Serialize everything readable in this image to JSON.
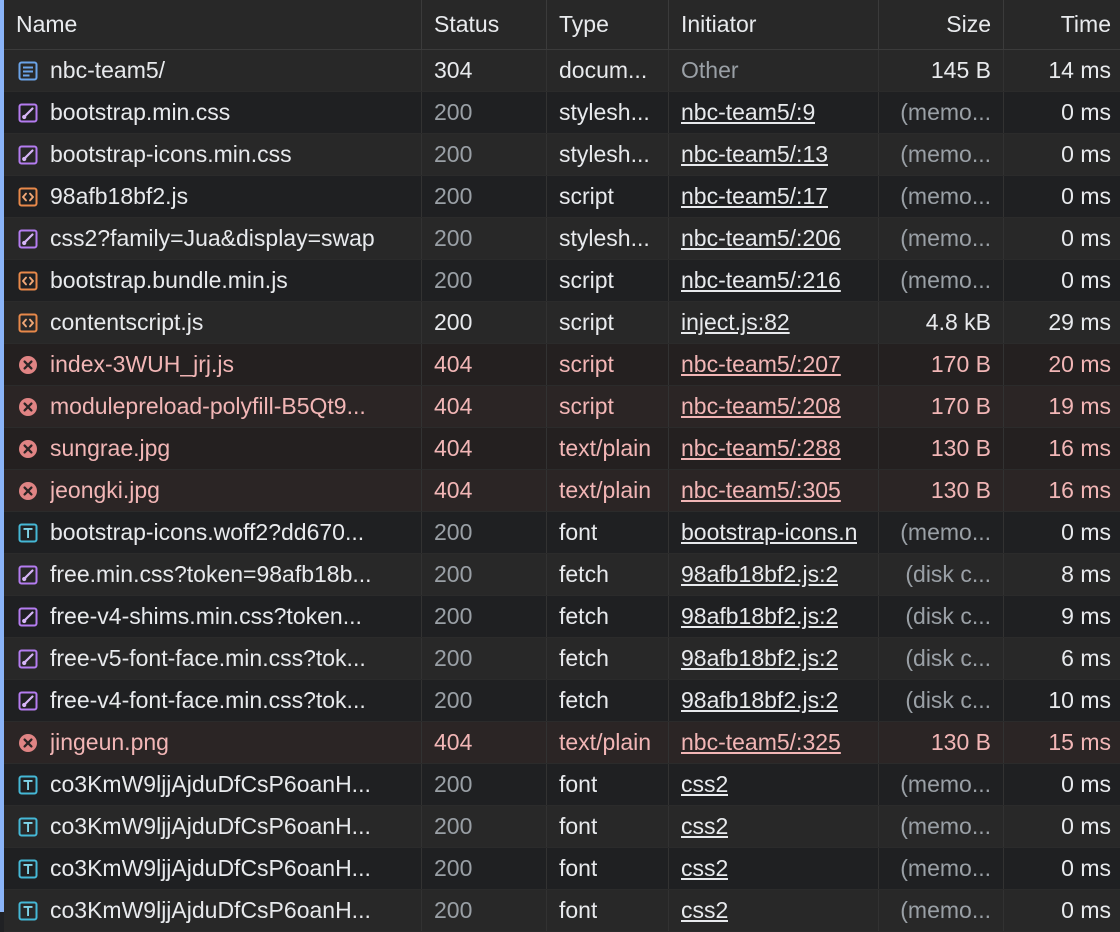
{
  "panel": {
    "name": "network-requests-table",
    "accent_color": "#8ab4f8",
    "error_text_color": "#f2b6b6",
    "muted_text_color": "#9aa0a6"
  },
  "columns": [
    {
      "key": "name",
      "label": "Name"
    },
    {
      "key": "status",
      "label": "Status"
    },
    {
      "key": "type",
      "label": "Type"
    },
    {
      "key": "initiator",
      "label": "Initiator"
    },
    {
      "key": "size",
      "label": "Size"
    },
    {
      "key": "time",
      "label": "Time"
    }
  ],
  "rows": [
    {
      "icon": "document-icon",
      "name": "nbc-team5/",
      "status": "304",
      "status_style": "bright",
      "type": "docum...",
      "initiator": "Other",
      "initiator_style": "plain-muted",
      "size": "145 B",
      "size_style": "bright",
      "time": "14 ms",
      "error": false
    },
    {
      "icon": "stylesheet-icon",
      "name": "bootstrap.min.css",
      "status": "200",
      "status_style": "muted",
      "type": "stylesh...",
      "initiator": "nbc-team5/:9",
      "initiator_style": "link",
      "size": "(memo...",
      "size_style": "muted",
      "time": "0 ms",
      "error": false
    },
    {
      "icon": "stylesheet-icon",
      "name": "bootstrap-icons.min.css",
      "status": "200",
      "status_style": "muted",
      "type": "stylesh...",
      "initiator": "nbc-team5/:13",
      "initiator_style": "link",
      "size": "(memo...",
      "size_style": "muted",
      "time": "0 ms",
      "error": false
    },
    {
      "icon": "script-icon",
      "name": "98afb18bf2.js",
      "status": "200",
      "status_style": "muted",
      "type": "script",
      "initiator": "nbc-team5/:17",
      "initiator_style": "link",
      "size": "(memo...",
      "size_style": "muted",
      "time": "0 ms",
      "error": false
    },
    {
      "icon": "stylesheet-icon",
      "name": "css2?family=Jua&display=swap",
      "status": "200",
      "status_style": "muted",
      "type": "stylesh...",
      "initiator": "nbc-team5/:206",
      "initiator_style": "link",
      "size": "(memo...",
      "size_style": "muted",
      "time": "0 ms",
      "error": false
    },
    {
      "icon": "script-icon",
      "name": "bootstrap.bundle.min.js",
      "status": "200",
      "status_style": "muted",
      "type": "script",
      "initiator": "nbc-team5/:216",
      "initiator_style": "link",
      "size": "(memo...",
      "size_style": "muted",
      "time": "0 ms",
      "error": false
    },
    {
      "icon": "script-icon",
      "name": "contentscript.js",
      "status": "200",
      "status_style": "bright",
      "type": "script",
      "initiator": "inject.js:82",
      "initiator_style": "link",
      "size": "4.8 kB",
      "size_style": "bright",
      "time": "29 ms",
      "error": false
    },
    {
      "icon": "error-icon",
      "name": "index-3WUH_jrj.js",
      "status": "404",
      "status_style": "bright",
      "type": "script",
      "initiator": "nbc-team5/:207",
      "initiator_style": "link",
      "size": "170 B",
      "size_style": "bright",
      "time": "20 ms",
      "error": true
    },
    {
      "icon": "error-icon",
      "name": "modulepreload-polyfill-B5Qt9...",
      "status": "404",
      "status_style": "bright",
      "type": "script",
      "initiator": "nbc-team5/:208",
      "initiator_style": "link",
      "size": "170 B",
      "size_style": "bright",
      "time": "19 ms",
      "error": true
    },
    {
      "icon": "error-icon",
      "name": "sungrae.jpg",
      "status": "404",
      "status_style": "bright",
      "type": "text/plain",
      "initiator": "nbc-team5/:288",
      "initiator_style": "link",
      "size": "130 B",
      "size_style": "bright",
      "time": "16 ms",
      "error": true
    },
    {
      "icon": "error-icon",
      "name": "jeongki.jpg",
      "status": "404",
      "status_style": "bright",
      "type": "text/plain",
      "initiator": "nbc-team5/:305",
      "initiator_style": "link",
      "size": "130 B",
      "size_style": "bright",
      "time": "16 ms",
      "error": true
    },
    {
      "icon": "font-icon",
      "name": "bootstrap-icons.woff2?dd670...",
      "status": "200",
      "status_style": "muted",
      "type": "font",
      "initiator": "bootstrap-icons.n",
      "initiator_style": "link",
      "size": "(memo...",
      "size_style": "muted",
      "time": "0 ms",
      "error": false
    },
    {
      "icon": "stylesheet-icon",
      "name": "free.min.css?token=98afb18b...",
      "status": "200",
      "status_style": "muted",
      "type": "fetch",
      "initiator": "98afb18bf2.js:2",
      "initiator_style": "link",
      "size": "(disk c...",
      "size_style": "muted",
      "time": "8 ms",
      "error": false
    },
    {
      "icon": "stylesheet-icon",
      "name": "free-v4-shims.min.css?token...",
      "status": "200",
      "status_style": "muted",
      "type": "fetch",
      "initiator": "98afb18bf2.js:2",
      "initiator_style": "link",
      "size": "(disk c...",
      "size_style": "muted",
      "time": "9 ms",
      "error": false
    },
    {
      "icon": "stylesheet-icon",
      "name": "free-v5-font-face.min.css?tok...",
      "status": "200",
      "status_style": "muted",
      "type": "fetch",
      "initiator": "98afb18bf2.js:2",
      "initiator_style": "link",
      "size": "(disk c...",
      "size_style": "muted",
      "time": "6 ms",
      "error": false
    },
    {
      "icon": "stylesheet-icon",
      "name": "free-v4-font-face.min.css?tok...",
      "status": "200",
      "status_style": "muted",
      "type": "fetch",
      "initiator": "98afb18bf2.js:2",
      "initiator_style": "link",
      "size": "(disk c...",
      "size_style": "muted",
      "time": "10 ms",
      "error": false
    },
    {
      "icon": "error-icon",
      "name": "jingeun.png",
      "status": "404",
      "status_style": "bright",
      "type": "text/plain",
      "initiator": "nbc-team5/:325",
      "initiator_style": "link",
      "size": "130 B",
      "size_style": "bright",
      "time": "15 ms",
      "error": true
    },
    {
      "icon": "font-icon",
      "name": "co3KmW9ljjAjduDfCsP6oanH...",
      "status": "200",
      "status_style": "muted",
      "type": "font",
      "initiator": "css2",
      "initiator_style": "link",
      "size": "(memo...",
      "size_style": "muted",
      "time": "0 ms",
      "error": false
    },
    {
      "icon": "font-icon",
      "name": "co3KmW9ljjAjduDfCsP6oanH...",
      "status": "200",
      "status_style": "muted",
      "type": "font",
      "initiator": "css2",
      "initiator_style": "link",
      "size": "(memo...",
      "size_style": "muted",
      "time": "0 ms",
      "error": false
    },
    {
      "icon": "font-icon",
      "name": "co3KmW9ljjAjduDfCsP6oanH...",
      "status": "200",
      "status_style": "muted",
      "type": "font",
      "initiator": "css2",
      "initiator_style": "link",
      "size": "(memo...",
      "size_style": "muted",
      "time": "0 ms",
      "error": false
    },
    {
      "icon": "font-icon",
      "name": "co3KmW9ljjAjduDfCsP6oanH...",
      "status": "200",
      "status_style": "muted",
      "type": "font",
      "initiator": "css2",
      "initiator_style": "link",
      "size": "(memo...",
      "size_style": "muted",
      "time": "0 ms",
      "error": false
    }
  ]
}
